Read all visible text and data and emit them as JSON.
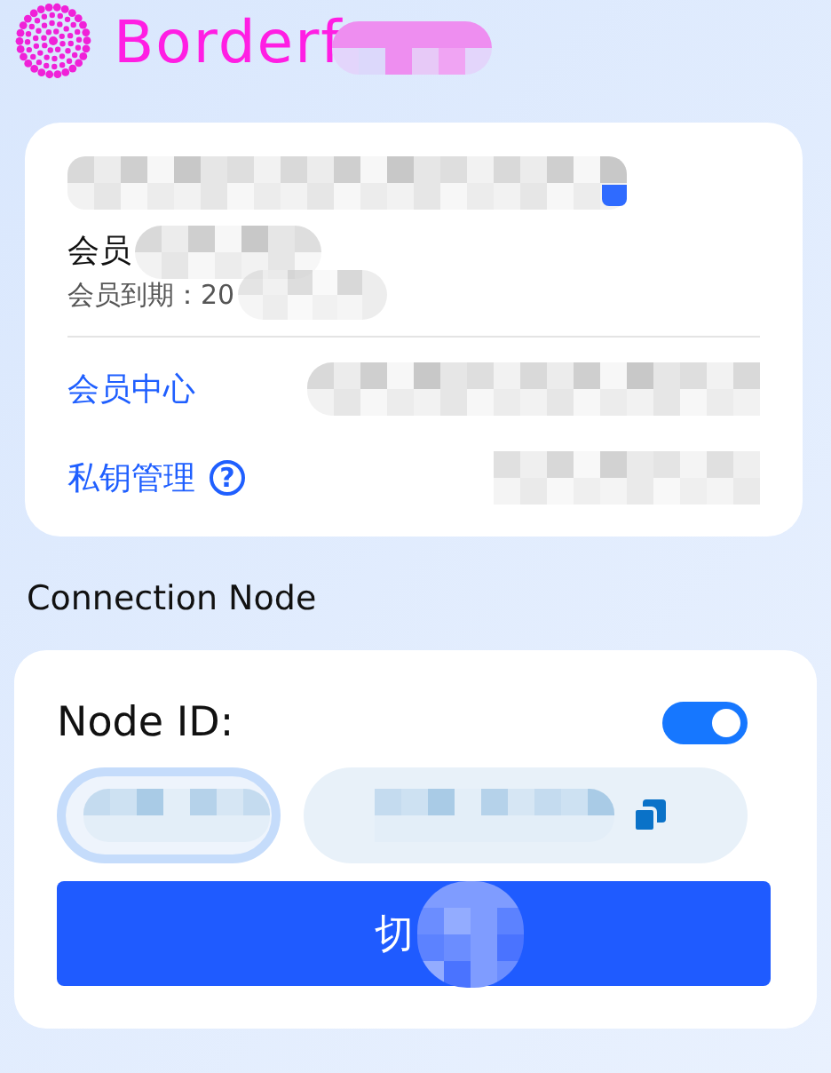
{
  "app": {
    "brand": "Borderf"
  },
  "account": {
    "member_label": "会员",
    "expiry": "会员到期：20",
    "links": [
      {
        "label": "会员中心"
      },
      {
        "label": "私钥管理",
        "help_icon": "?"
      }
    ]
  },
  "connection": {
    "title": "Connection Node",
    "node_label": "Node ID:",
    "auto_switch": {
      "on": true
    },
    "switch_button": "切"
  }
}
